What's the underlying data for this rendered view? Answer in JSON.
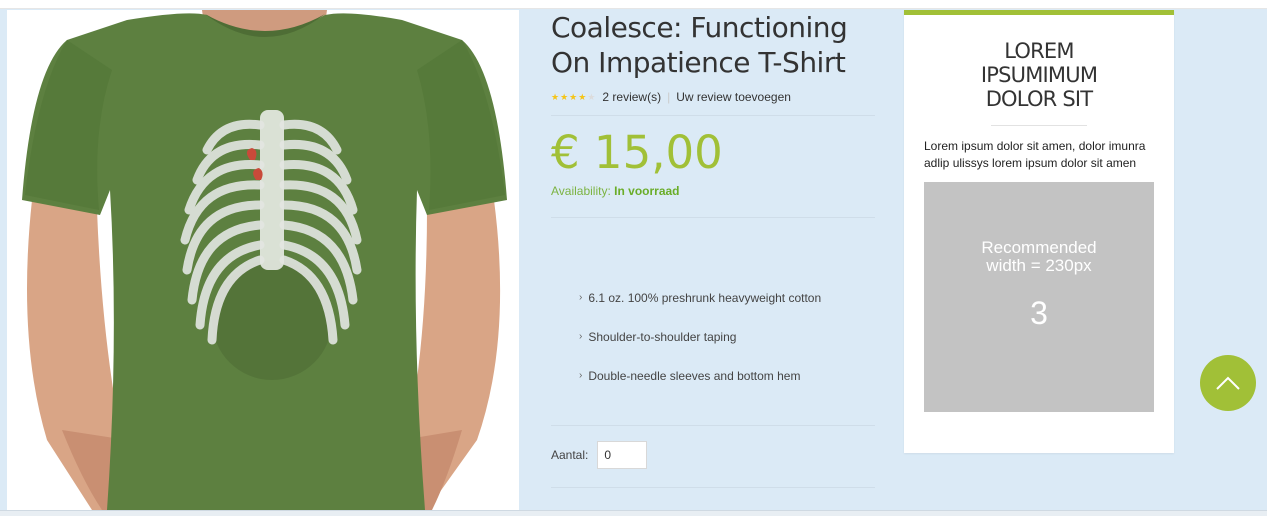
{
  "product": {
    "title": "Coalesce: Functioning On Impatience T-Shirt",
    "rating_stars": 4,
    "reviews_label": "2 review(s)",
    "add_review_label": "Uw review toevoegen",
    "price": "€ 15,00",
    "availability_label": "Availability:",
    "availability_value": "In voorraad",
    "features": [
      "6.1 oz. 100% preshrunk heavyweight cotton",
      "Shoulder-to-shoulder taping",
      "Double-needle sleeves and bottom hem"
    ],
    "qty_label": "Aantal:",
    "qty_value": "0"
  },
  "sidebar": {
    "title": "LOREM IPSUMIMUM DOLOR SIT",
    "text": "Lorem ipsum dolor sit amen, dolor imunra adlip ulissys lorem ipsum dolor sit amen",
    "banner_text": "Recommended\nwidth = 230px",
    "banner_number": "3"
  },
  "icons": {
    "star": "star-icon",
    "chevron": "chevron-right-icon",
    "scroll_top": "chevron-up-icon"
  },
  "colors": {
    "accent": "#a1c037",
    "star": "#f5c518",
    "background": "#dbeaf6",
    "shirt": "#5d8040"
  }
}
